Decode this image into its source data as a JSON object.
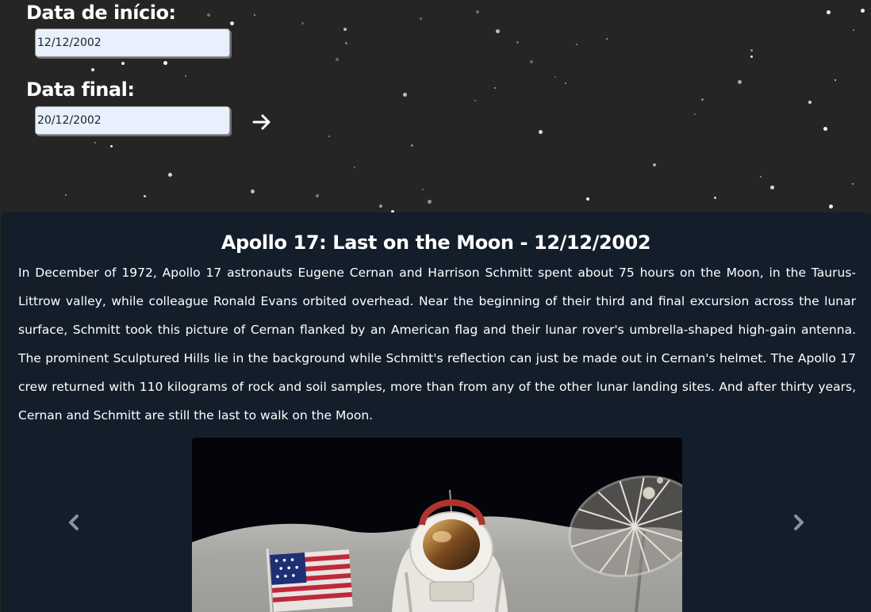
{
  "form": {
    "start_label": "Data de início:",
    "start_value": "12/12/2002",
    "end_label": "Data final:",
    "end_value": "20/12/2002"
  },
  "apod": {
    "title": "Apollo 17: Last on the Moon - 12/12/2002",
    "explanation": "In December of 1972, Apollo 17 astronauts Eugene Cernan and Harrison Schmitt spent about 75 hours on the Moon, in the Taurus-Littrow valley, while colleague Ronald Evans orbited overhead. Near the beginning of their third and final excursion across the lunar surface, Schmitt took this picture of Cernan flanked by an American flag and their lunar rover's umbrella-shaped high-gain antenna. The prominent Sculptured Hills lie in the background while Schmitt's reflection can just be made out in Cernan's helmet. The Apollo 17 crew returned with 110 kilograms of rock and soil samples, more than from any of the other lunar landing sites. And after thirty years, Cernan and Schmitt are still the last to walk on the Moon."
  },
  "icons": {
    "submit": "arrow-right-icon",
    "prev": "chevron-left-icon",
    "next": "chevron-right-icon"
  },
  "colors": {
    "background": "#252525",
    "card": "#141e2b",
    "input": "#e8f0fe",
    "text": "#ffffff"
  }
}
